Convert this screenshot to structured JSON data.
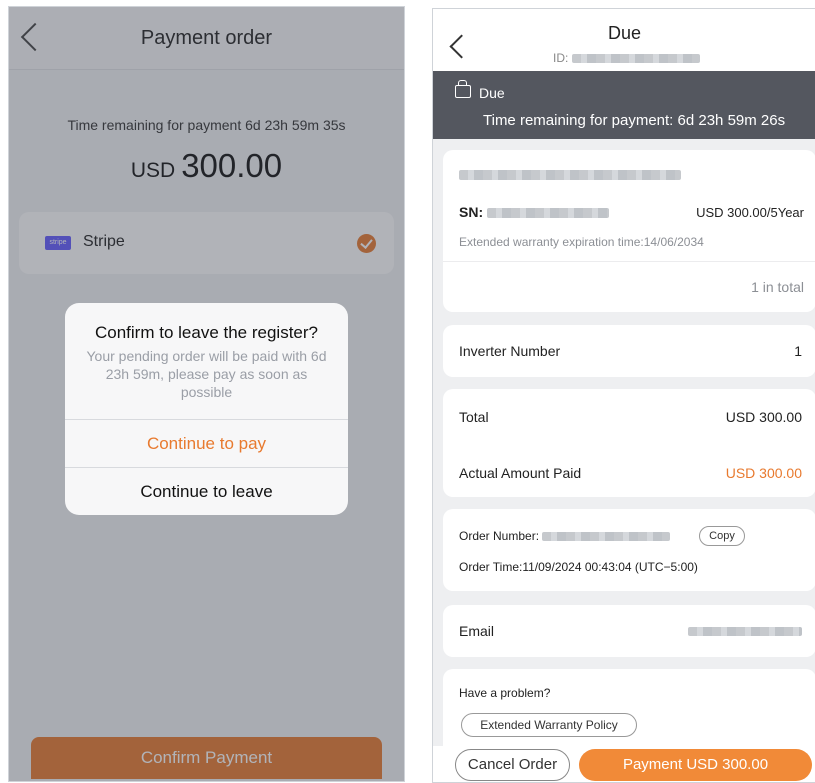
{
  "left": {
    "nav": {
      "title": "Payment order"
    },
    "timer_text": "Time remaining for payment 6d 23h 59m 35s",
    "amount": {
      "currency": "USD",
      "value": "300.00"
    },
    "payment_method": {
      "label": "Stripe",
      "logo_text": "stripe",
      "selected": true
    },
    "confirm_button": "Confirm Payment",
    "dialog": {
      "title": "Confirm to leave the register?",
      "message": "Your pending order will be paid with 6d 23h 59m, please pay as soon as possible",
      "primary_button": "Continue to pay",
      "secondary_button": "Continue to leave"
    }
  },
  "right": {
    "nav": {
      "title": "Due",
      "id_label": "ID:"
    },
    "banner": {
      "status": "Due",
      "time_text": "Time remaining for payment: 6d 23h 59m 26s"
    },
    "product": {
      "sn_label": "SN:",
      "price": "USD 300.00/5Year",
      "warranty": "Extended warranty expiration time:14/06/2034",
      "count": "1 in total"
    },
    "inverter": {
      "label": "Inverter Number",
      "value": "1"
    },
    "totals": {
      "total_label": "Total",
      "total_value": "USD 300.00",
      "paid_label": "Actual Amount Paid",
      "paid_value": "USD 300.00"
    },
    "order": {
      "number_label": "Order Number:",
      "copy_button": "Copy",
      "time": "Order Time:11/09/2024 00:43:04 (UTC−5:00)"
    },
    "email": {
      "label": "Email"
    },
    "problem": {
      "label": "Have a problem?",
      "policy_button": "Extended Warranty Policy"
    },
    "bottom": {
      "cancel_button": "Cancel Order",
      "pay_button": "Payment USD 300.00"
    }
  },
  "colors": {
    "accent": "#e87a2f",
    "banner": "#54575f",
    "stripe": "#635bff"
  },
  "icons": [
    "back-arrow-icon",
    "bag-icon",
    "check-icon",
    "stripe-logo"
  ]
}
